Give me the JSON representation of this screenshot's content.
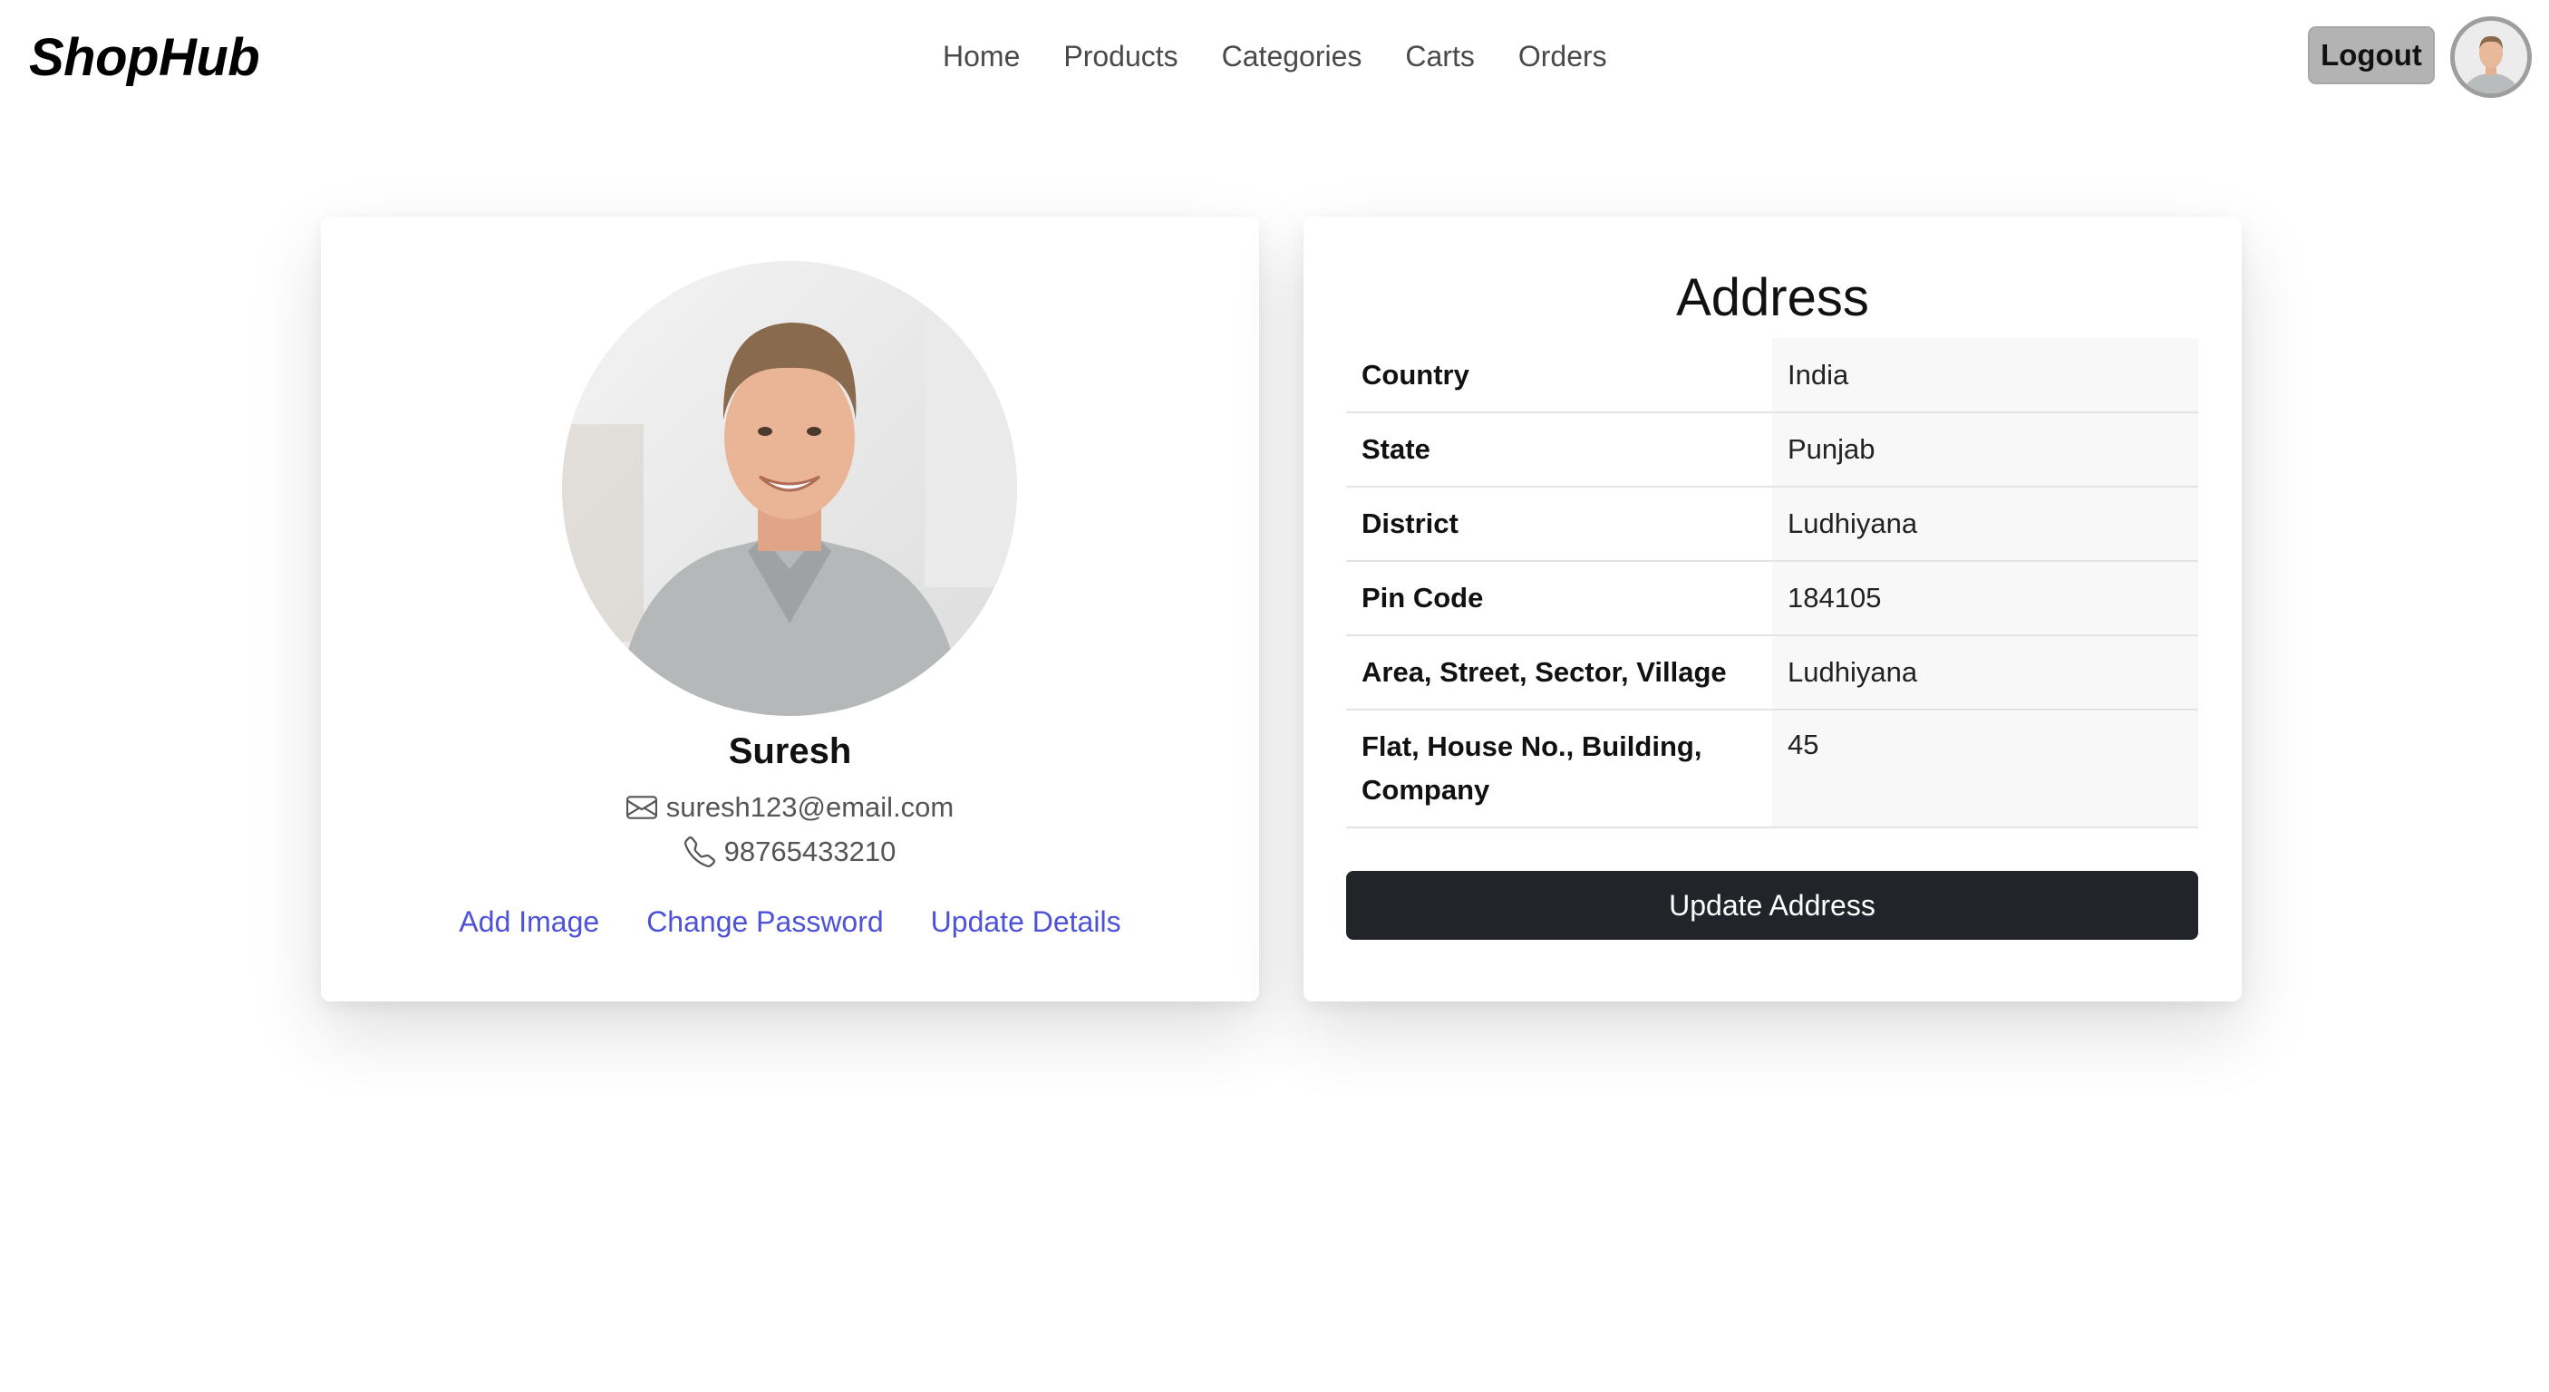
{
  "brand": "ShopHub",
  "nav": {
    "links": [
      "Home",
      "Products",
      "Categories",
      "Carts",
      "Orders"
    ],
    "logout_label": "Logout"
  },
  "profile": {
    "name": "Suresh",
    "email": "suresh123@email.com",
    "phone": "98765433210",
    "actions": [
      "Add Image",
      "Change Password",
      "Update Details"
    ]
  },
  "address": {
    "title": "Address",
    "rows": [
      {
        "label": "Country",
        "value": "India"
      },
      {
        "label": "State",
        "value": "Punjab"
      },
      {
        "label": "District",
        "value": "Ludhiyana"
      },
      {
        "label": "Pin Code",
        "value": "184105"
      },
      {
        "label": "Area, Street, Sector, Village",
        "value": "Ludhiyana"
      },
      {
        "label": "Flat, House No., Building, Company",
        "value": "45"
      }
    ],
    "button_label": "Update Address"
  },
  "icons": {
    "email": "envelope-icon",
    "phone": "phone-icon"
  },
  "colors": {
    "link": "#4e52d8",
    "button_dark": "#212529",
    "logout_bg": "#b3b3b3"
  }
}
